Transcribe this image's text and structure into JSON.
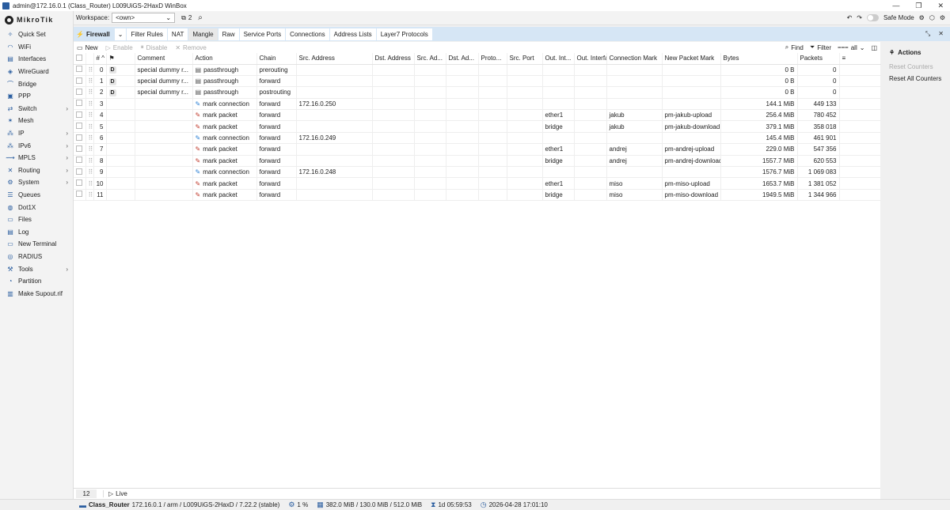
{
  "window": {
    "title": "admin@172.16.0.1 (Class_Router) L009UiGS-2HaxD WinBox"
  },
  "brand": {
    "logo_text": "MikroTik",
    "accent": "#2a5d9f"
  },
  "sidebar": {
    "items": [
      {
        "label": "Quick Set",
        "icon": "wand-icon",
        "arrow": false
      },
      {
        "label": "WiFi",
        "icon": "wifi-icon",
        "arrow": false
      },
      {
        "label": "Interfaces",
        "icon": "interfaces-icon",
        "arrow": false
      },
      {
        "label": "WireGuard",
        "icon": "wireguard-icon",
        "arrow": false
      },
      {
        "label": "Bridge",
        "icon": "bridge-icon",
        "arrow": false
      },
      {
        "label": "PPP",
        "icon": "ppp-icon",
        "arrow": false
      },
      {
        "label": "Switch",
        "icon": "switch-icon",
        "arrow": true
      },
      {
        "label": "Mesh",
        "icon": "mesh-icon",
        "arrow": false
      },
      {
        "label": "IP",
        "icon": "ip-icon",
        "arrow": true
      },
      {
        "label": "IPv6",
        "icon": "ipv6-icon",
        "arrow": true
      },
      {
        "label": "MPLS",
        "icon": "mpls-icon",
        "arrow": true
      },
      {
        "label": "Routing",
        "icon": "routing-icon",
        "arrow": true
      },
      {
        "label": "System",
        "icon": "gear-icon",
        "arrow": true
      },
      {
        "label": "Queues",
        "icon": "queues-icon",
        "arrow": false
      },
      {
        "label": "Dot1X",
        "icon": "dot1x-icon",
        "arrow": false
      },
      {
        "label": "Files",
        "icon": "folder-icon",
        "arrow": false
      },
      {
        "label": "Log",
        "icon": "log-icon",
        "arrow": false
      },
      {
        "label": "New Terminal",
        "icon": "terminal-icon",
        "arrow": false
      },
      {
        "label": "RADIUS",
        "icon": "radius-icon",
        "arrow": false
      },
      {
        "label": "Tools",
        "icon": "tools-icon",
        "arrow": true
      },
      {
        "label": "Partition",
        "icon": "partition-icon",
        "arrow": false
      },
      {
        "label": "Make Supout.rif",
        "icon": "supout-icon",
        "arrow": false
      }
    ]
  },
  "topbar": {
    "workspace_label": "Workspace:",
    "workspace_value": "<own>",
    "window_count": "2",
    "safe_mode_label": "Safe Mode"
  },
  "tabs": {
    "section": "Firewall",
    "items": [
      "Filter Rules",
      "NAT",
      "Mangle",
      "Raw",
      "Service Ports",
      "Connections",
      "Address Lists",
      "Layer7 Protocols"
    ],
    "active": "Mangle"
  },
  "toolbar": {
    "new": "New",
    "enable": "Enable",
    "disable": "Disable",
    "remove": "Remove",
    "find": "Find",
    "filter": "Filter",
    "all": "all"
  },
  "table": {
    "columns": [
      "#",
      "Comment",
      "Action",
      "Chain",
      "Src. Address",
      "Dst. Address",
      "Src. Ad...",
      "Dst. Ad...",
      "Proto...",
      "Src. Port",
      "Out. Int...",
      "Out. Interface List",
      "Connection Mark",
      "New Packet Mark",
      "Bytes",
      "Packets"
    ],
    "rows": [
      {
        "n": "0",
        "d": "D",
        "comment": "special dummy r...",
        "action": "passthrough",
        "atype": "pass",
        "chain": "prerouting",
        "src": "",
        "outif": "",
        "connmark": "",
        "pktmark": "",
        "bytes": "0 B",
        "packets": "0"
      },
      {
        "n": "1",
        "d": "D",
        "comment": "special dummy r...",
        "action": "passthrough",
        "atype": "pass",
        "chain": "forward",
        "src": "",
        "outif": "",
        "connmark": "",
        "pktmark": "",
        "bytes": "0 B",
        "packets": "0"
      },
      {
        "n": "2",
        "d": "D",
        "comment": "special dummy r...",
        "action": "passthrough",
        "atype": "pass",
        "chain": "postrouting",
        "src": "",
        "outif": "",
        "connmark": "",
        "pktmark": "",
        "bytes": "0 B",
        "packets": "0"
      },
      {
        "n": "3",
        "d": "",
        "comment": "",
        "action": "mark connection",
        "atype": "conn",
        "chain": "forward",
        "src": "172.16.0.250",
        "outif": "",
        "connmark": "",
        "pktmark": "",
        "bytes": "144.1 MiB",
        "packets": "449 133"
      },
      {
        "n": "4",
        "d": "",
        "comment": "",
        "action": "mark packet",
        "atype": "pkt",
        "chain": "forward",
        "src": "",
        "outif": "ether1",
        "connmark": "jakub",
        "pktmark": "pm-jakub-upload",
        "bytes": "256.4 MiB",
        "packets": "780 452"
      },
      {
        "n": "5",
        "d": "",
        "comment": "",
        "action": "mark packet",
        "atype": "pkt",
        "chain": "forward",
        "src": "",
        "outif": "bridge",
        "connmark": "jakub",
        "pktmark": "pm-jakub-download",
        "bytes": "379.1 MiB",
        "packets": "358 018"
      },
      {
        "n": "6",
        "d": "",
        "comment": "",
        "action": "mark connection",
        "atype": "conn",
        "chain": "forward",
        "src": "172.16.0.249",
        "outif": "",
        "connmark": "",
        "pktmark": "",
        "bytes": "145.4 MiB",
        "packets": "461 901"
      },
      {
        "n": "7",
        "d": "",
        "comment": "",
        "action": "mark packet",
        "atype": "pkt",
        "chain": "forward",
        "src": "",
        "outif": "ether1",
        "connmark": "andrej",
        "pktmark": "pm-andrej-upload",
        "bytes": "229.0 MiB",
        "packets": "547 356"
      },
      {
        "n": "8",
        "d": "",
        "comment": "",
        "action": "mark packet",
        "atype": "pkt",
        "chain": "forward",
        "src": "",
        "outif": "bridge",
        "connmark": "andrej",
        "pktmark": "pm-andrej-download",
        "bytes": "1557.7 MiB",
        "packets": "620 553"
      },
      {
        "n": "9",
        "d": "",
        "comment": "",
        "action": "mark connection",
        "atype": "conn",
        "chain": "forward",
        "src": "172.16.0.248",
        "outif": "",
        "connmark": "",
        "pktmark": "",
        "bytes": "1576.7 MiB",
        "packets": "1 069 083"
      },
      {
        "n": "10",
        "d": "",
        "comment": "",
        "action": "mark packet",
        "atype": "pkt",
        "chain": "forward",
        "src": "",
        "outif": "ether1",
        "connmark": "miso",
        "pktmark": "pm-miso-upload",
        "bytes": "1653.7 MiB",
        "packets": "1 381 052"
      },
      {
        "n": "11",
        "d": "",
        "comment": "",
        "action": "mark packet",
        "atype": "pkt",
        "chain": "forward",
        "src": "",
        "outif": "bridge",
        "connmark": "miso",
        "pktmark": "pm-miso-download",
        "bytes": "1949.5 MiB",
        "packets": "1 344 966"
      }
    ]
  },
  "footer": {
    "count": "12",
    "live": "Live"
  },
  "actions": {
    "title": "Actions",
    "reset_counters": "Reset Counters",
    "reset_all": "Reset All Counters"
  },
  "status": {
    "router": "Class_Router",
    "info": "172.16.0.1 / arm / L009UiGS-2HaxD / 7.22.2 (stable)",
    "cpu": "1 %",
    "memory": "382.0 MiB / 130.0 MiB / 512.0 MiB",
    "uptime": "1d 05:59:53",
    "datetime": "2026-04-28 17:01:10"
  }
}
